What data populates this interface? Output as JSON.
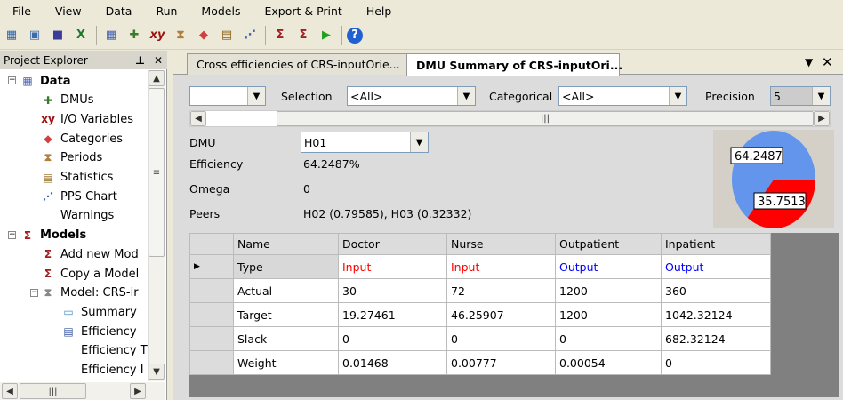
{
  "menu": [
    "File",
    "View",
    "Data",
    "Run",
    "Models",
    "Export & Print",
    "Help"
  ],
  "toolbar_icons": [
    "new-project-icon",
    "open-icon",
    "save-icon",
    "excel-icon",
    "data-table-icon",
    "dmus-icon",
    "io-variables-icon",
    "periods-icon",
    "categories-icon",
    "statistics-icon",
    "pps-chart-icon",
    "add-model-icon",
    "copy-model-icon",
    "run-icon",
    "help-icon"
  ],
  "explorer": {
    "title": "Project Explorer",
    "items": [
      {
        "label": "Data",
        "bold": true
      },
      {
        "label": "DMUs"
      },
      {
        "label": "I/O Variables"
      },
      {
        "label": "Categories"
      },
      {
        "label": "Periods"
      },
      {
        "label": "Statistics"
      },
      {
        "label": "PPS Chart"
      },
      {
        "label": "Warnings"
      },
      {
        "label": "Models",
        "bold": true
      },
      {
        "label": "Add new Mod"
      },
      {
        "label": "Copy a Model"
      },
      {
        "label": "Model: CRS-ir"
      },
      {
        "label": "Summary"
      },
      {
        "label": "Efficiency"
      },
      {
        "label": "Efficiency T"
      },
      {
        "label": "Efficiency I"
      }
    ]
  },
  "tabs": [
    {
      "label": "Cross efficiencies of CRS-inputOrie...",
      "active": false
    },
    {
      "label": "DMU Summary of CRS-inputOri...",
      "active": true
    }
  ],
  "filters": {
    "first_value": "",
    "selection_label": "Selection",
    "selection_value": "<All>",
    "categorical_label": "Categorical",
    "categorical_value": "<All>",
    "precision_label": "Precision",
    "precision_value": "5"
  },
  "summary": {
    "dmu_label": "DMU",
    "dmu_value": "H01",
    "efficiency_label": "Efficiency",
    "efficiency_value": "64.2487%",
    "omega_label": "Omega",
    "omega_value": "0",
    "peers_label": "Peers",
    "peers_value": "H02 (0.79585), H03 (0.32332)"
  },
  "chart_data": {
    "type": "pie",
    "values": [
      64.2487,
      35.7513
    ],
    "labels": [
      "64.2487",
      "35.7513"
    ],
    "colors": [
      "#6495ed",
      "#ff0000"
    ]
  },
  "table": {
    "columns": [
      "Name",
      "Doctor",
      "Nurse",
      "Outpatient",
      "Inpatient"
    ],
    "rows": [
      [
        "Type",
        "Input",
        "Input",
        "Output",
        "Output"
      ],
      [
        "Actual",
        "30",
        "72",
        "1200",
        "360"
      ],
      [
        "Target",
        "19.27461",
        "46.25907",
        "1200",
        "1042.32124"
      ],
      [
        "Slack",
        "0",
        "0",
        "0",
        "682.32124"
      ],
      [
        "Weight",
        "0.01468",
        "0.00777",
        "0.00054",
        "0"
      ]
    ]
  },
  "colors": {
    "input": "#ff0000",
    "output": "#0000ff"
  }
}
